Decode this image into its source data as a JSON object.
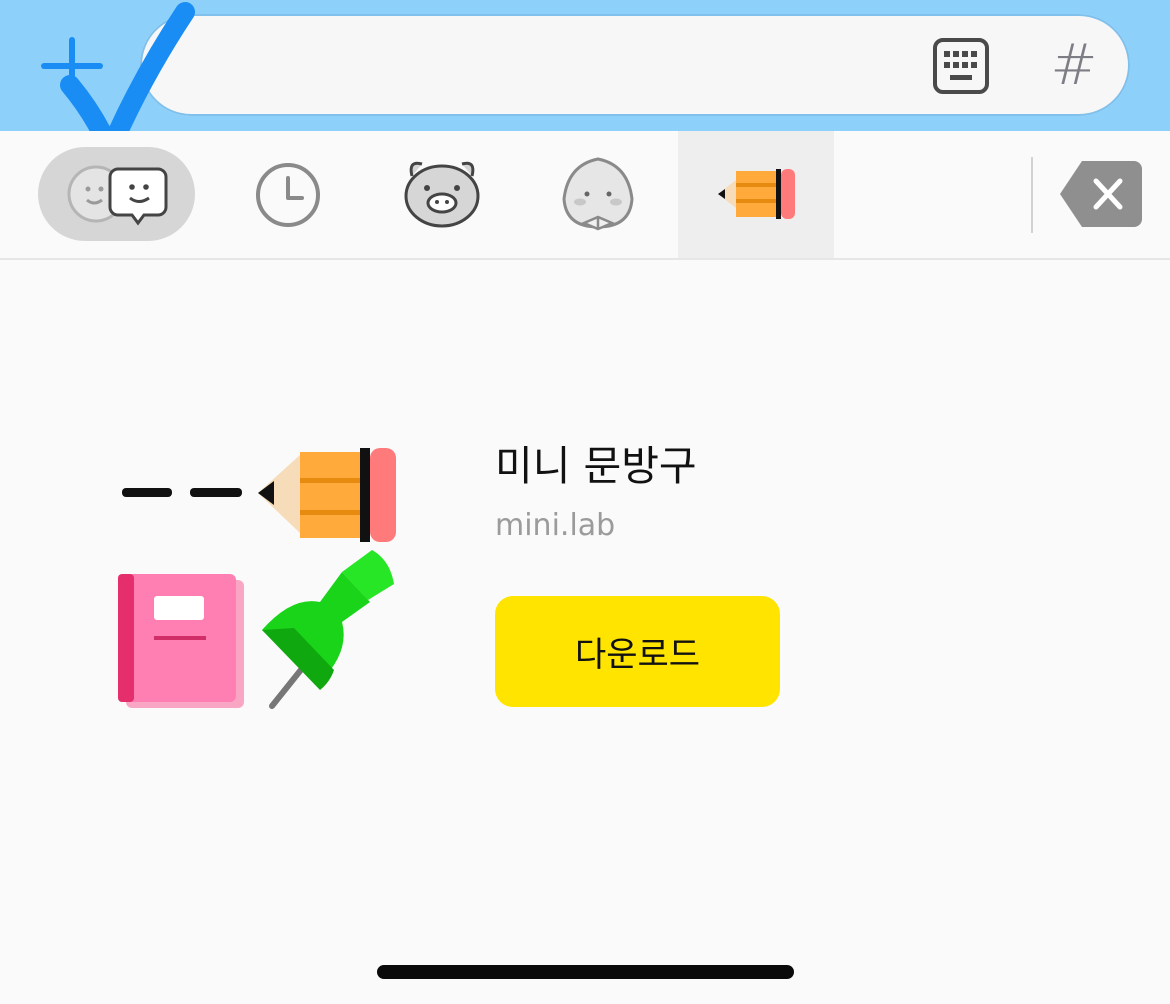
{
  "composer": {
    "input_placeholder": "",
    "hash_label": "#"
  },
  "tabs": [
    {
      "name": "emoticon",
      "icon": "emoticon-faces-icon",
      "selected": false
    },
    {
      "name": "recent",
      "icon": "clock-icon",
      "selected": false
    },
    {
      "name": "pig",
      "icon": "pig-face-icon",
      "selected": false
    },
    {
      "name": "peach",
      "icon": "peach-character-icon",
      "selected": false
    },
    {
      "name": "pencil",
      "icon": "pencil-icon",
      "selected": true
    }
  ],
  "sticker_pack": {
    "title": "미니 문방구",
    "author": "mini.lab",
    "download_label": "다운로드",
    "preview_icons": [
      "pencil-icon",
      "notebook-icon",
      "pushpin-icon"
    ]
  },
  "colors": {
    "topbar": "#8dd1fb",
    "download_button": "#ffe400",
    "checkmark": "#1a8df5"
  }
}
